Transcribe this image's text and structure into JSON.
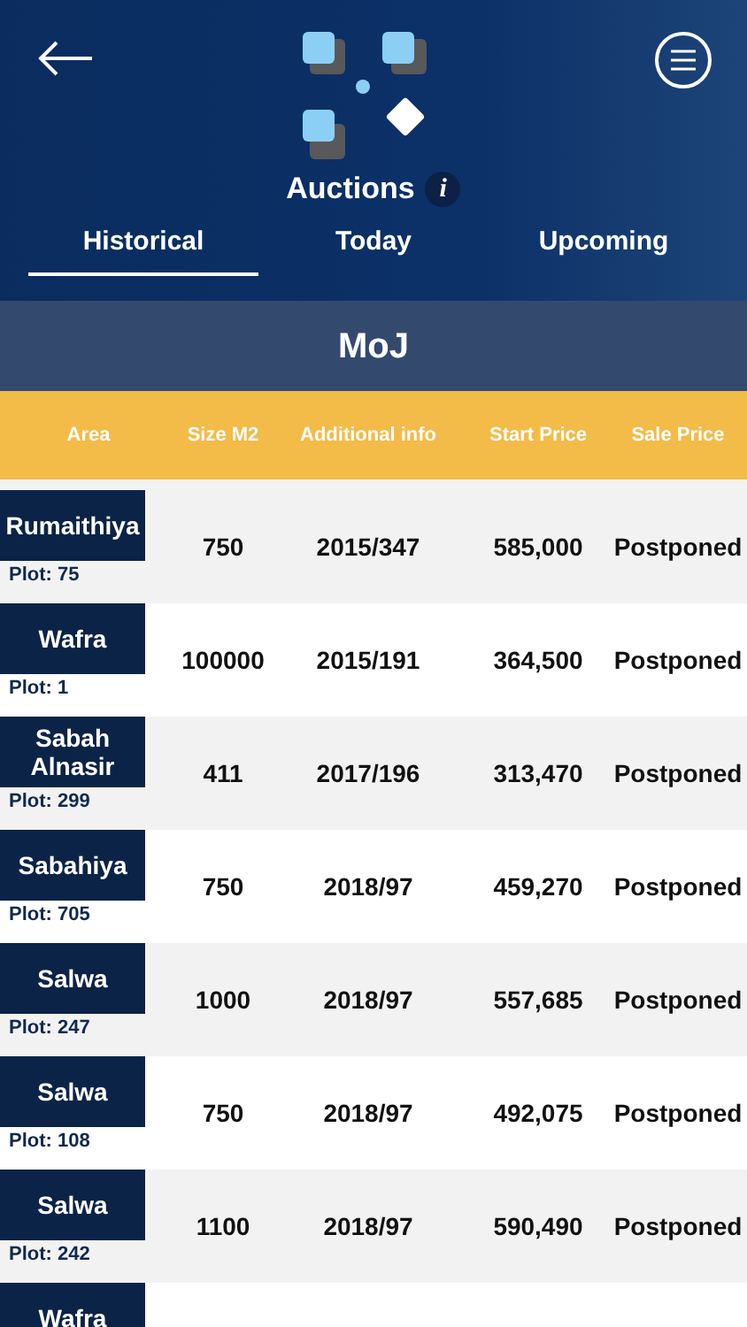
{
  "header": {
    "title": "Auctions",
    "info_glyph": "i"
  },
  "tabs": [
    {
      "label": "Historical",
      "selected": true
    },
    {
      "label": "Today",
      "selected": false
    },
    {
      "label": "Upcoming",
      "selected": false
    }
  ],
  "section": {
    "title": "MoJ"
  },
  "table": {
    "columns": [
      "Area",
      "Size M2",
      "Additional info",
      "Start Price",
      "Sale Price"
    ],
    "rows": [
      {
        "area": "Rumaithiya",
        "plot": "Plot: 75",
        "size": "750",
        "info": "2015/347",
        "start": "585,000",
        "sale": "Postponed"
      },
      {
        "area": "Wafra",
        "plot": "Plot: 1",
        "size": "100000",
        "info": "2015/191",
        "start": "364,500",
        "sale": "Postponed"
      },
      {
        "area": "Sabah Alnasir",
        "plot": "Plot: 299",
        "size": "411",
        "info": "2017/196",
        "start": "313,470",
        "sale": "Postponed"
      },
      {
        "area": "Sabahiya",
        "plot": "Plot: 705",
        "size": "750",
        "info": "2018/97",
        "start": "459,270",
        "sale": "Postponed"
      },
      {
        "area": "Salwa",
        "plot": "Plot: 247",
        "size": "1000",
        "info": "2018/97",
        "start": "557,685",
        "sale": "Postponed"
      },
      {
        "area": "Salwa",
        "plot": "Plot: 108",
        "size": "750",
        "info": "2018/97",
        "start": "492,075",
        "sale": "Postponed"
      },
      {
        "area": "Salwa",
        "plot": "Plot: 242",
        "size": "1100",
        "info": "2018/97",
        "start": "590,490",
        "sale": "Postponed"
      },
      {
        "area": "Wafra"
      }
    ]
  }
}
